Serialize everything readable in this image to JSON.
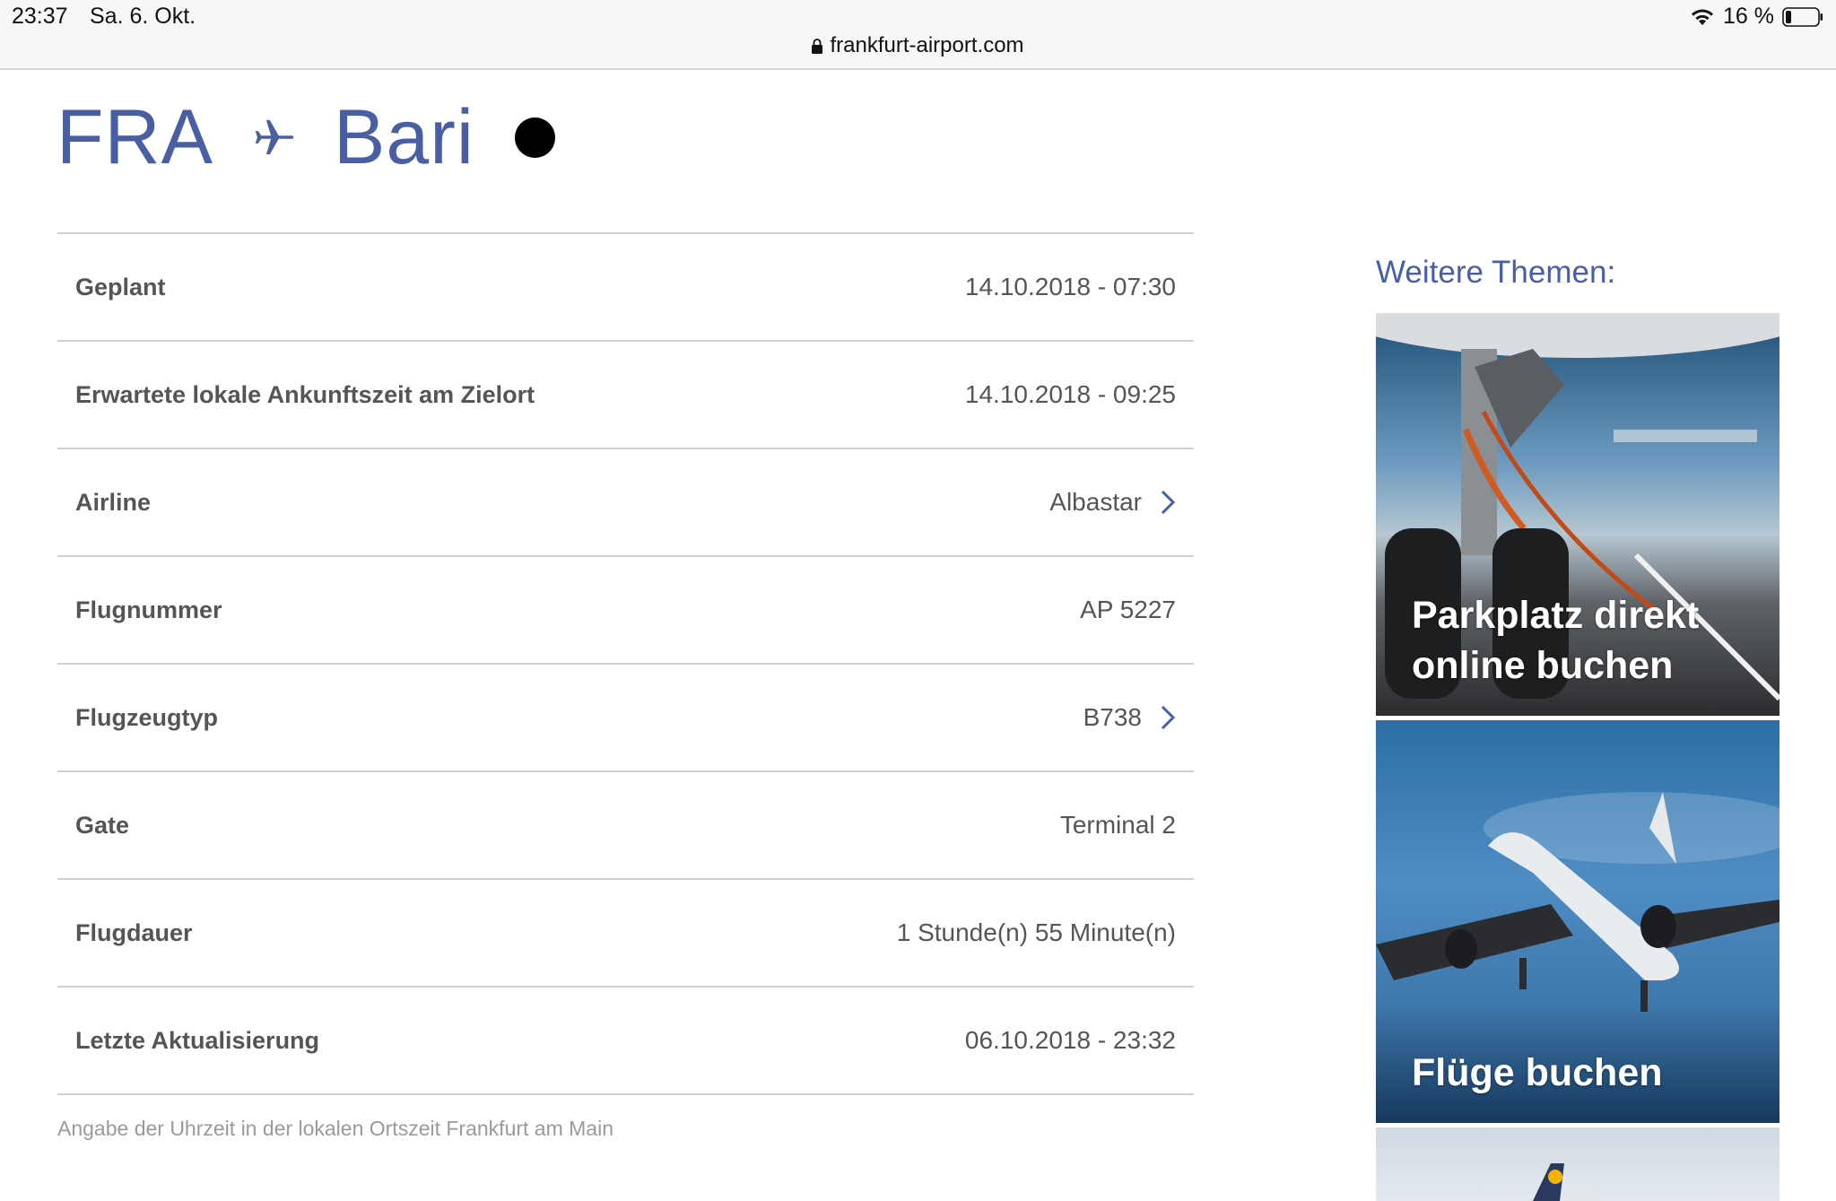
{
  "status_bar": {
    "time": "23:37",
    "date": "Sa. 6. Okt.",
    "battery": "16 %",
    "url": "frankfurt-airport.com"
  },
  "heading": {
    "origin": "FRA",
    "destination": "Bari",
    "plane_icon": "plane-icon",
    "accent_color": "#4a5fa3"
  },
  "flight_info": {
    "rows": [
      {
        "label": "Geplant",
        "value": "14.10.2018 - 07:30"
      },
      {
        "label": "Erwartete lokale Ankunftszeit am Zielort",
        "value": "14.10.2018 - 09:25"
      },
      {
        "label": "Airline",
        "value": "Albastar"
      },
      {
        "label": "Flugnummer",
        "value": "AP 5227"
      },
      {
        "label": "Flugzeugtyp",
        "value": "B738"
      },
      {
        "label": "Gate",
        "value": "Terminal 2"
      },
      {
        "label": "Flugdauer",
        "value": "1 Stunde(n) 55 Minute(n)"
      },
      {
        "label": "Letzte Aktualisierung",
        "value": "06.10.2018 - 23:32"
      }
    ],
    "footnote": "Angabe der Uhrzeit in der lokalen Ortszeit Frankfurt am Main"
  },
  "sidebar": {
    "title": "Weitere Themen:",
    "tiles": [
      {
        "text": "Parkplatz direkt online buchen"
      },
      {
        "text": "Flüge buchen"
      }
    ]
  }
}
